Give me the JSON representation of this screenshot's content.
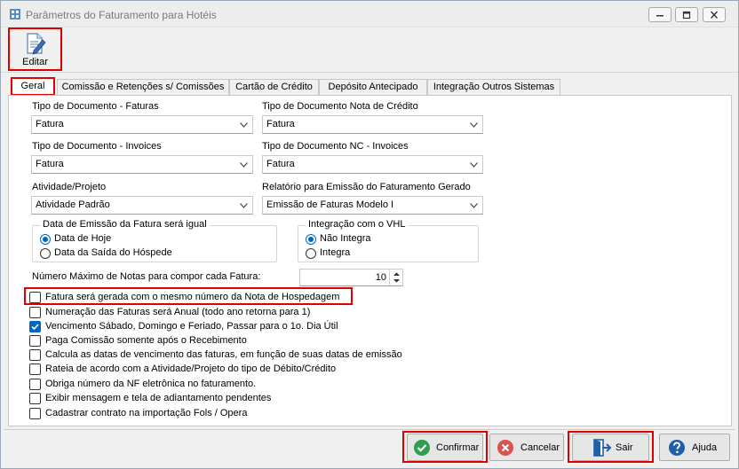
{
  "window": {
    "title": "Parâmetros do Faturamento para Hotéis",
    "controls": [
      "minimize-icon",
      "restore-icon",
      "close-icon"
    ]
  },
  "toolbar": {
    "edit_label": "Editar"
  },
  "tabs": [
    {
      "label": "Geral",
      "active": true
    },
    {
      "label": "Comissão e Retenções s/ Comissões",
      "active": false
    },
    {
      "label": "Cartão de Crédito",
      "active": false
    },
    {
      "label": "Depósito Antecipado",
      "active": false
    },
    {
      "label": "Integração Outros Sistemas",
      "active": false
    }
  ],
  "fields": {
    "tipo_doc_faturas": {
      "label": "Tipo de Documento - Faturas",
      "value": "Fatura"
    },
    "tipo_doc_nota_credito": {
      "label": "Tipo de Documento Nota de Crédito",
      "value": "Fatura"
    },
    "tipo_doc_invoices": {
      "label": "Tipo de Documento - Invoices",
      "value": "Fatura"
    },
    "tipo_doc_nc_invoices": {
      "label": "Tipo de Documento NC - Invoices",
      "value": "Fatura"
    },
    "atividade_projeto": {
      "label": "Atividade/Projeto",
      "value": "Atividade Padrão"
    },
    "relatorio_emissao": {
      "label": "Relatório para Emissão do Faturamento Gerado",
      "value": "Emissão de Faturas Modelo I"
    }
  },
  "data_emissao_group": {
    "title": "Data de Emissão da Fatura será igual",
    "options": [
      {
        "label": "Data de Hoje",
        "selected": true
      },
      {
        "label": "Data da Saída do Hóspede",
        "selected": false
      }
    ]
  },
  "integracao_vhl_group": {
    "title": "Integração com o VHL",
    "options": [
      {
        "label": "Não Integra",
        "selected": true
      },
      {
        "label": "Integra",
        "selected": false
      }
    ]
  },
  "max_notas": {
    "label": "Número Máximo de Notas para compor cada Fatura:",
    "value": "10"
  },
  "checkboxes": [
    {
      "label": "Fatura será gerada com o mesmo número da Nota de Hospedagem",
      "checked": false
    },
    {
      "label": "Numeração das Faturas será Anual (todo ano retorna para 1)",
      "checked": false
    },
    {
      "label": "Vencimento Sábado, Domingo e Feriado, Passar para o 1o. Dia Útil",
      "checked": true
    },
    {
      "label": "Paga Comissão somente após o Recebimento",
      "checked": false
    },
    {
      "label": "Calcula as datas de vencimento das faturas,  em função de suas datas de emissão",
      "checked": false
    },
    {
      "label": "Rateia de acordo com a Atividade/Projeto do tipo de Débito/Crédito",
      "checked": false
    },
    {
      "label": "Obriga número da NF eletrônica no faturamento.",
      "checked": false
    },
    {
      "label": "Exibir mensagem e tela de adiantamento pendentes",
      "checked": false
    },
    {
      "label": "Cadastrar contrato na importação Fols / Opera",
      "checked": false
    }
  ],
  "buttons": {
    "confirmar": "Confirmar",
    "cancelar": "Cancelar",
    "sair": "Sair",
    "ajuda": "Ajuda"
  },
  "colors": {
    "accent": "#0067c0",
    "highlight_frame": "#e00000",
    "confirm_icon": "#2e9e4f",
    "cancel_icon": "#d9534f",
    "help_icon": "#1f5fa8"
  }
}
